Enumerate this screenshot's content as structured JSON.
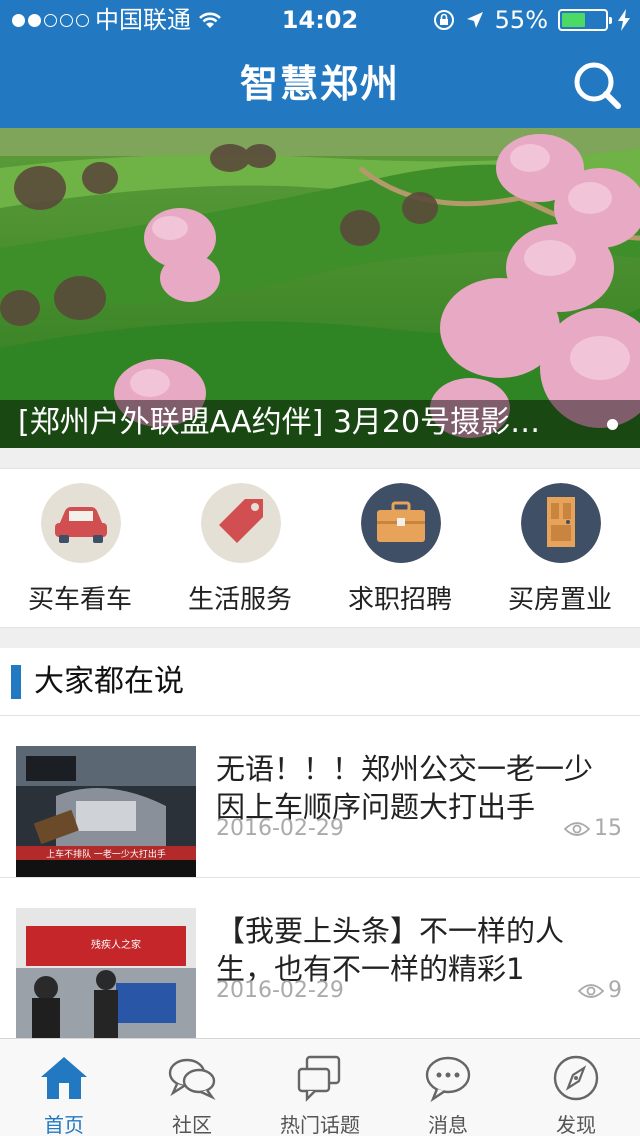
{
  "status_bar": {
    "carrier": "中国联通",
    "time": "14:02",
    "battery": "55%"
  },
  "header": {
    "title": "智慧郑州"
  },
  "banner": {
    "caption": "[郑州户外联盟AA约伴] 3月20号摄影…"
  },
  "quick_links": [
    {
      "label": "买车看车",
      "icon": "car-icon",
      "color": "#e5e0d6"
    },
    {
      "label": "生活服务",
      "icon": "tag-icon",
      "color": "#e5e0d6"
    },
    {
      "label": "求职招聘",
      "icon": "briefcase-icon",
      "color": "#3f4f66"
    },
    {
      "label": "买房置业",
      "icon": "door-icon",
      "color": "#3f4f66"
    }
  ],
  "section": {
    "title": "大家都在说"
  },
  "news": [
    {
      "title": "无语！！！郑州公交一老一少因上车顺序问题大打出手",
      "date": "2016-02-29",
      "views": "15",
      "thumb_caption": "上车不排队 一老一少大打出手"
    },
    {
      "title": "【我要上头条】不一样的人生，也有不一样的精彩1",
      "date": "2016-02-29",
      "views": "9",
      "thumb_caption": "残疾人之家"
    }
  ],
  "tabbar": [
    {
      "label": "首页",
      "icon": "home-icon",
      "active": true
    },
    {
      "label": "社区",
      "icon": "chat-bubbles-icon",
      "active": false
    },
    {
      "label": "热门话题",
      "icon": "topics-icon",
      "active": false
    },
    {
      "label": "消息",
      "icon": "message-icon",
      "active": false
    },
    {
      "label": "发现",
      "icon": "compass-icon",
      "active": false
    }
  ],
  "colors": {
    "brand": "#2379c1",
    "tab_active": "#2379c1"
  }
}
